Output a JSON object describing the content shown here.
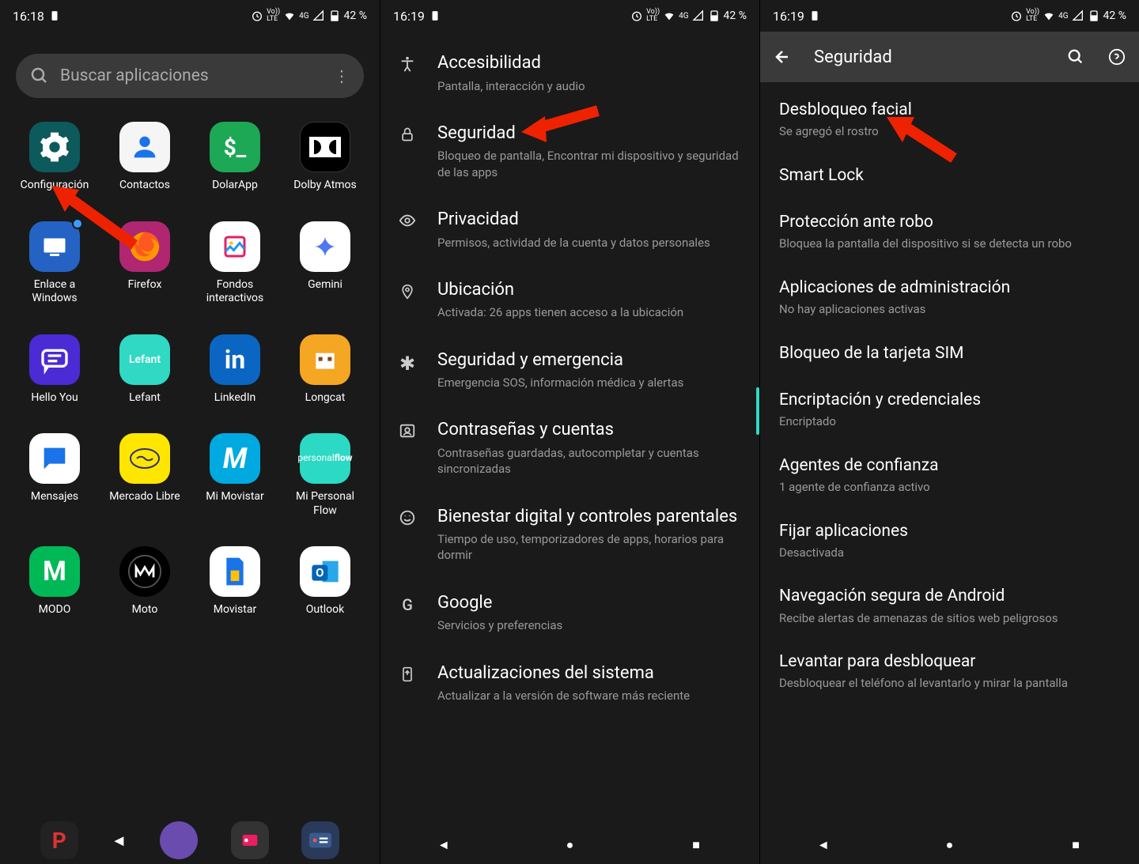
{
  "statusbar": {
    "time1": "16:18",
    "time23": "16:19",
    "battery": "42 %",
    "net": "4G",
    "volte": "Vo))\nLTE"
  },
  "screen1": {
    "search_placeholder": "Buscar aplicaciones",
    "apps": [
      {
        "label": "Configuración"
      },
      {
        "label": "Contactos"
      },
      {
        "label": "DolarApp"
      },
      {
        "label": "Dolby Atmos"
      },
      {
        "label": "Enlace a Windows"
      },
      {
        "label": "Firefox"
      },
      {
        "label": "Fondos interactivos"
      },
      {
        "label": "Gemini"
      },
      {
        "label": "Hello You"
      },
      {
        "label": "Lefant"
      },
      {
        "label": "LinkedIn"
      },
      {
        "label": "Longcat"
      },
      {
        "label": "Mensajes"
      },
      {
        "label": "Mercado Libre"
      },
      {
        "label": "Mi Movistar"
      },
      {
        "label": "Mi Personal Flow"
      },
      {
        "label": "MODO"
      },
      {
        "label": "Moto"
      },
      {
        "label": "Movistar"
      },
      {
        "label": "Outlook"
      }
    ]
  },
  "screen2": {
    "items": [
      {
        "title": "Accesibilidad",
        "sub": "Pantalla, interacción y audio"
      },
      {
        "title": "Seguridad",
        "sub": "Bloqueo de pantalla, Encontrar mi dispositivo y seguridad de las apps"
      },
      {
        "title": "Privacidad",
        "sub": "Permisos, actividad de la cuenta y datos personales"
      },
      {
        "title": "Ubicación",
        "sub": "Activada: 26 apps tienen acceso a la ubicación"
      },
      {
        "title": "Seguridad y emergencia",
        "sub": "Emergencia SOS, información médica y alertas"
      },
      {
        "title": "Contraseñas y cuentas",
        "sub": "Contraseñas guardadas, autocompletar y cuentas sincronizadas"
      },
      {
        "title": "Bienestar digital y controles parentales",
        "sub": "Tiempo de uso, temporizadores de apps, horarios para dormir"
      },
      {
        "title": "Google",
        "sub": "Servicios y preferencias"
      },
      {
        "title": "Actualizaciones del sistema",
        "sub": "Actualizar a la versión de software más reciente"
      }
    ]
  },
  "screen3": {
    "header": "Seguridad",
    "items": [
      {
        "title": "Desbloqueo facial",
        "sub": "Se agregó el rostro"
      },
      {
        "title": "Smart Lock",
        "sub": ""
      },
      {
        "title": "Protección ante robo",
        "sub": "Bloquea la pantalla del dispositivo si se detecta un robo"
      },
      {
        "title": "Aplicaciones de administración",
        "sub": "No hay aplicaciones activas"
      },
      {
        "title": "Bloqueo de la tarjeta SIM",
        "sub": ""
      },
      {
        "title": "Encriptación y credenciales",
        "sub": "Encriptado"
      },
      {
        "title": "Agentes de confianza",
        "sub": "1 agente de confianza activo"
      },
      {
        "title": "Fijar aplicaciones",
        "sub": "Desactivada"
      },
      {
        "title": "Navegación segura de Android",
        "sub": "Recibe alertas de amenazas de sitios web peligrosos"
      },
      {
        "title": "Levantar para desbloquear",
        "sub": "Desbloquear el teléfono al levantarlo y mirar la pantalla"
      }
    ]
  }
}
